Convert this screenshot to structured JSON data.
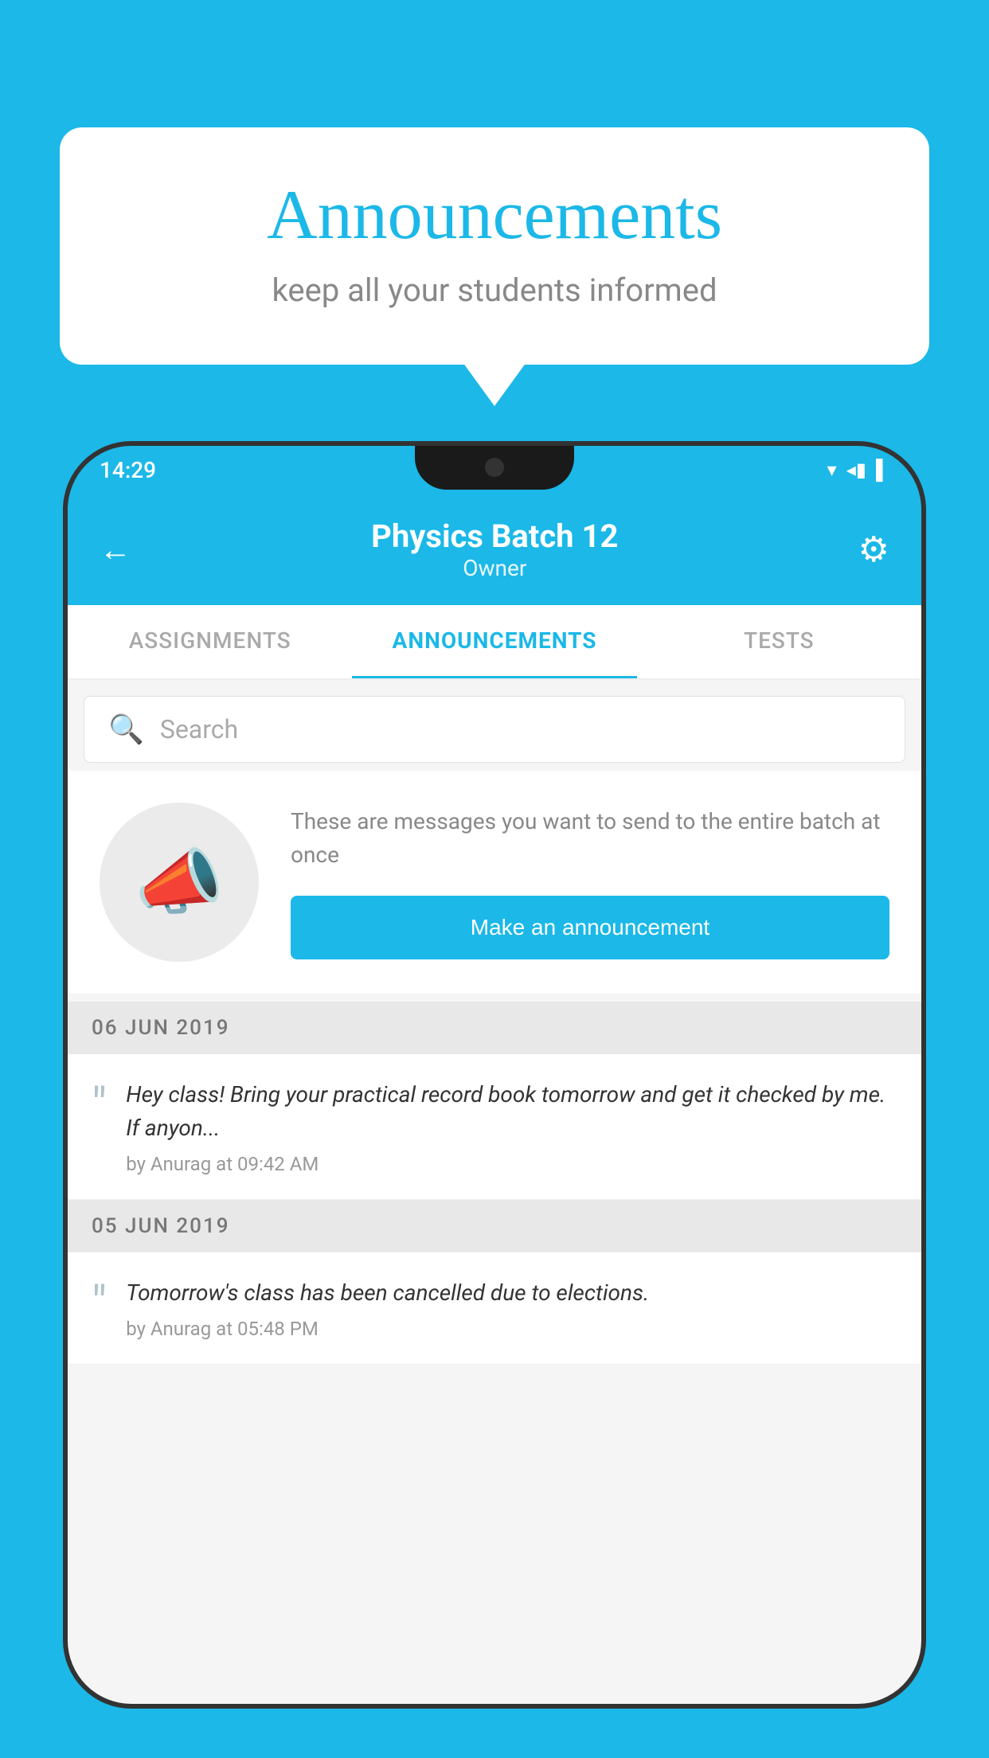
{
  "page": {
    "background_color": "#1BB8E8"
  },
  "speech_bubble": {
    "title": "Announcements",
    "subtitle": "keep all your students informed"
  },
  "phone": {
    "status_bar": {
      "time": "14:29",
      "wifi_icon": "▾",
      "signal_icon": "◂",
      "battery_icon": "▌"
    },
    "header": {
      "title": "Physics Batch 12",
      "subtitle": "Owner",
      "back_icon": "←",
      "gear_icon": "⚙"
    },
    "tabs": [
      {
        "label": "ASSIGNMENTS",
        "active": false
      },
      {
        "label": "ANNOUNCEMENTS",
        "active": true
      },
      {
        "label": "TESTS",
        "active": false
      }
    ],
    "search": {
      "placeholder": "Search"
    },
    "announcement_prompt": {
      "description": "These are messages you want to send to the entire batch at once",
      "button_label": "Make an announcement"
    },
    "announcements": [
      {
        "date": "06  JUN  2019",
        "message": "Hey class! Bring your practical record book tomorrow and get it checked by me. If anyon...",
        "by": "by Anurag at 09:42 AM"
      },
      {
        "date": "05  JUN  2019",
        "message": "Tomorrow's class has been cancelled due to elections.",
        "by": "by Anurag at 05:48 PM"
      }
    ]
  }
}
